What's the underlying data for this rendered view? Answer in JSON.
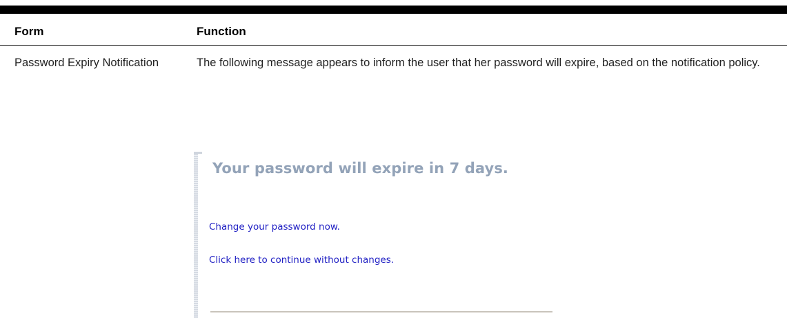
{
  "table": {
    "headers": {
      "form": "Form",
      "function": "Function"
    },
    "rows": [
      {
        "form": "Password Expiry Notification",
        "function": "The following message appears to inform the user that her password will expire, based on the notification policy."
      }
    ]
  },
  "notification": {
    "title": "Your password will expire in 7 days.",
    "change_link": "Change your password now.",
    "continue_link": "Click here to continue without changes."
  },
  "colors": {
    "title": "#93a3b8",
    "link": "#2222c4",
    "rule": "#000000"
  }
}
